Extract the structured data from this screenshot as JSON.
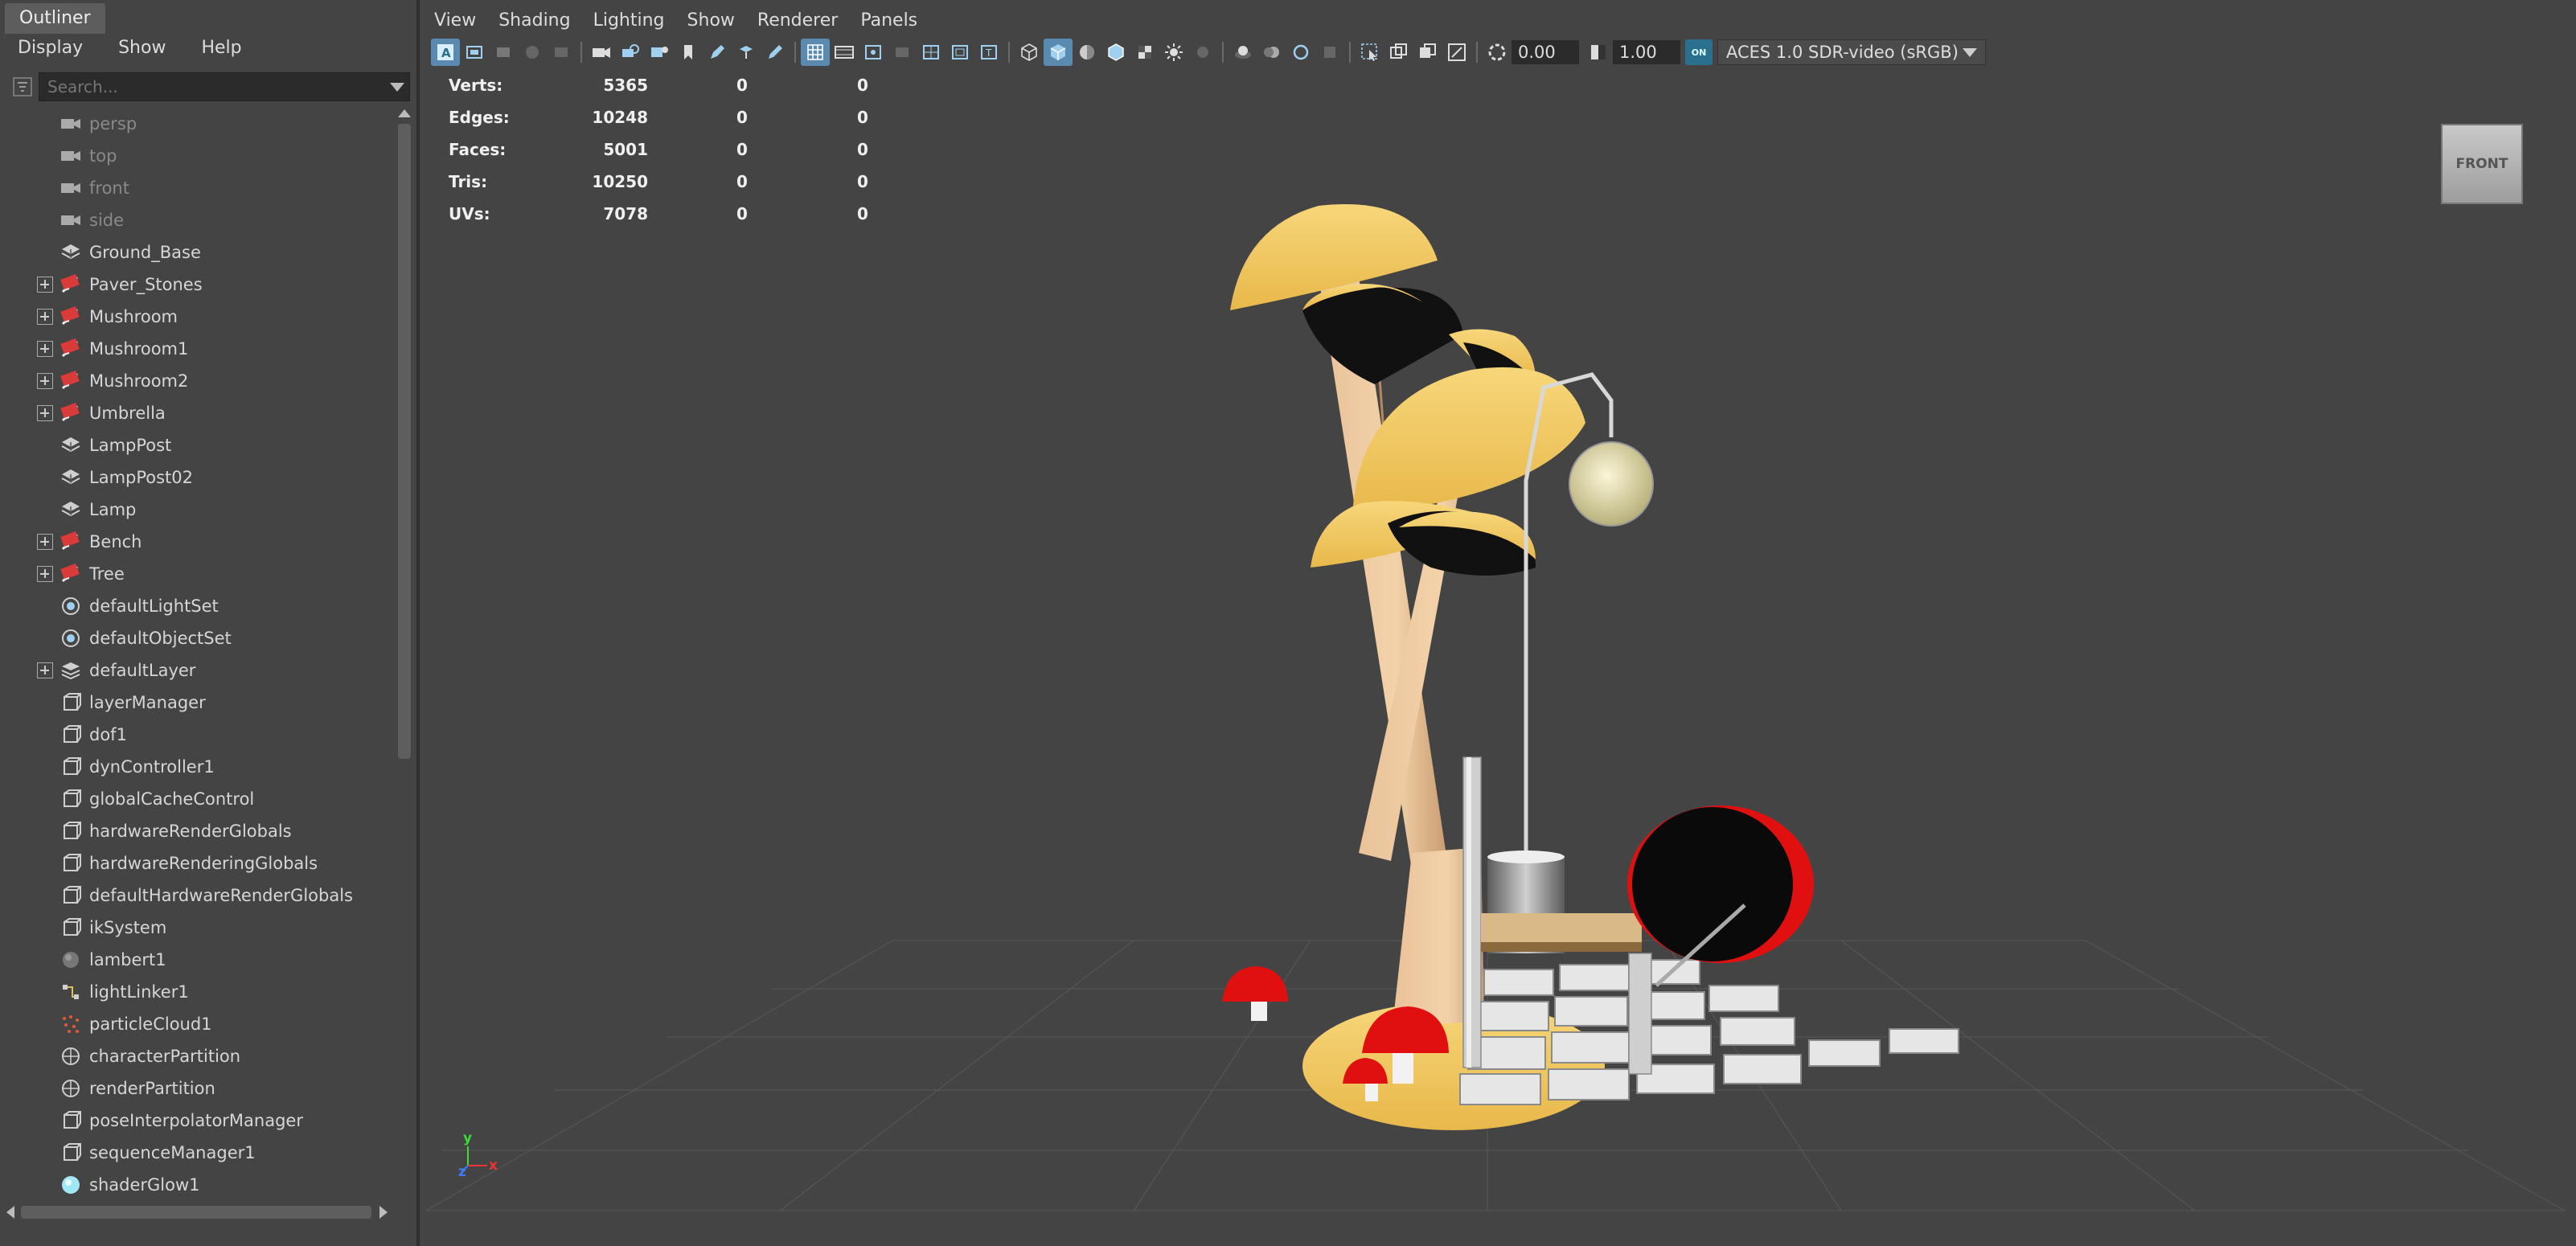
{
  "outliner": {
    "tab": "Outliner",
    "menus": [
      "Display",
      "Show",
      "Help"
    ],
    "search_placeholder": "Search...",
    "items": [
      {
        "label": "persp",
        "icon": "camera-icon",
        "expandable": false,
        "dim": true
      },
      {
        "label": "top",
        "icon": "camera-icon",
        "expandable": false,
        "dim": true
      },
      {
        "label": "front",
        "icon": "camera-icon",
        "expandable": false,
        "dim": true
      },
      {
        "label": "side",
        "icon": "camera-icon",
        "expandable": false,
        "dim": true
      },
      {
        "label": "Ground_Base",
        "icon": "mesh-icon",
        "expandable": false,
        "dim": false
      },
      {
        "label": "Paver_Stones",
        "icon": "group-icon",
        "expandable": true,
        "dim": false
      },
      {
        "label": "Mushroom",
        "icon": "group-icon",
        "expandable": true,
        "dim": false
      },
      {
        "label": "Mushroom1",
        "icon": "group-icon",
        "expandable": true,
        "dim": false
      },
      {
        "label": "Mushroom2",
        "icon": "group-icon",
        "expandable": true,
        "dim": false
      },
      {
        "label": "Umbrella",
        "icon": "group-icon",
        "expandable": true,
        "dim": false
      },
      {
        "label": "LampPost",
        "icon": "mesh-icon",
        "expandable": false,
        "dim": false
      },
      {
        "label": "LampPost02",
        "icon": "mesh-icon",
        "expandable": false,
        "dim": false
      },
      {
        "label": "Lamp",
        "icon": "mesh-icon",
        "expandable": false,
        "dim": false
      },
      {
        "label": "Bench",
        "icon": "group-icon",
        "expandable": true,
        "dim": false
      },
      {
        "label": "Tree",
        "icon": "group-icon",
        "expandable": true,
        "dim": false
      },
      {
        "label": "defaultLightSet",
        "icon": "set-icon",
        "expandable": false,
        "dim": false
      },
      {
        "label": "defaultObjectSet",
        "icon": "set-icon",
        "expandable": false,
        "dim": false
      },
      {
        "label": "defaultLayer",
        "icon": "layer-icon",
        "expandable": true,
        "dim": false
      },
      {
        "label": "layerManager",
        "icon": "node-icon",
        "expandable": false,
        "dim": false
      },
      {
        "label": "dof1",
        "icon": "node-icon",
        "expandable": false,
        "dim": false
      },
      {
        "label": "dynController1",
        "icon": "node-icon",
        "expandable": false,
        "dim": false
      },
      {
        "label": "globalCacheControl",
        "icon": "node-icon",
        "expandable": false,
        "dim": false
      },
      {
        "label": "hardwareRenderGlobals",
        "icon": "node-icon",
        "expandable": false,
        "dim": false
      },
      {
        "label": "hardwareRenderingGlobals",
        "icon": "node-icon",
        "expandable": false,
        "dim": false
      },
      {
        "label": "defaultHardwareRenderGlobals",
        "icon": "node-icon",
        "expandable": false,
        "dim": false
      },
      {
        "label": "ikSystem",
        "icon": "node-icon",
        "expandable": false,
        "dim": false
      },
      {
        "label": "lambert1",
        "icon": "material-icon",
        "expandable": false,
        "dim": false
      },
      {
        "label": "lightLinker1",
        "icon": "light-linker-icon",
        "expandable": false,
        "dim": false
      },
      {
        "label": "particleCloud1",
        "icon": "particle-icon",
        "expandable": false,
        "dim": false
      },
      {
        "label": "characterPartition",
        "icon": "partition-icon",
        "expandable": false,
        "dim": false
      },
      {
        "label": "renderPartition",
        "icon": "partition-icon",
        "expandable": false,
        "dim": false
      },
      {
        "label": "poseInterpolatorManager",
        "icon": "node-icon",
        "expandable": false,
        "dim": false
      },
      {
        "label": "sequenceManager1",
        "icon": "node-icon",
        "expandable": false,
        "dim": false
      },
      {
        "label": "shaderGlow1",
        "icon": "glow-icon",
        "expandable": false,
        "dim": false
      }
    ]
  },
  "viewport": {
    "menus": [
      "View",
      "Shading",
      "Lighting",
      "Show",
      "Renderer",
      "Panels"
    ],
    "exposure": "0.00",
    "gamma": "1.00",
    "color_mgmt_badge": "ON",
    "color_space": "ACES 1.0 SDR-video (sRGB)",
    "view_cube": "FRONT",
    "hud": [
      {
        "label": "Verts:",
        "v1": "5365",
        "v2": "0",
        "v3": "0"
      },
      {
        "label": "Edges:",
        "v1": "10248",
        "v2": "0",
        "v3": "0"
      },
      {
        "label": "Faces:",
        "v1": "5001",
        "v2": "0",
        "v3": "0"
      },
      {
        "label": "Tris:",
        "v1": "10250",
        "v2": "0",
        "v3": "0"
      },
      {
        "label": "UVs:",
        "v1": "7078",
        "v2": "0",
        "v3": "0"
      }
    ],
    "axis": {
      "y": "y",
      "x": "x",
      "z": "z"
    },
    "colors": {
      "background": "#444444",
      "accent": "#5b8ab0",
      "mushroom_cap": "#f3c85e",
      "red": "#e01010"
    }
  }
}
